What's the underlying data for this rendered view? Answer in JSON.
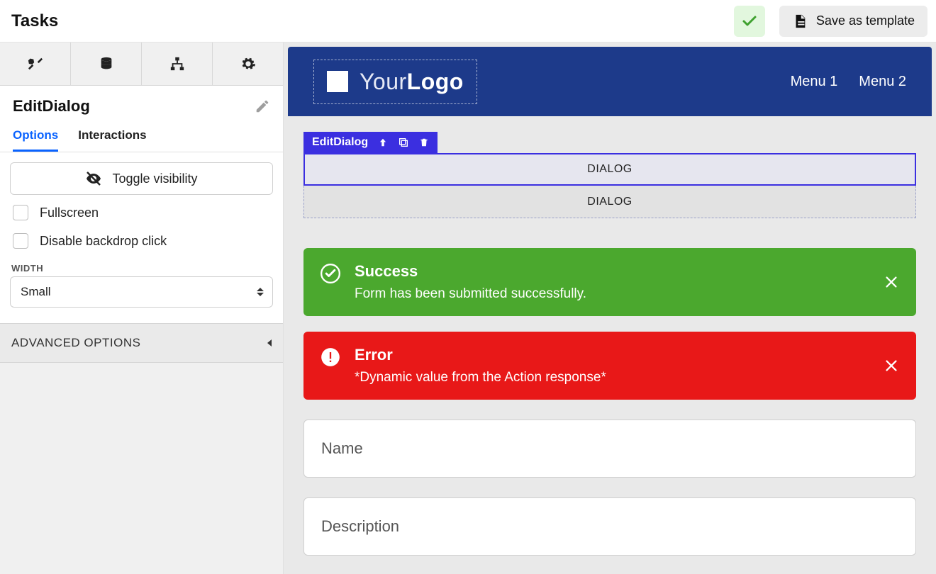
{
  "header": {
    "title": "Tasks",
    "save_label": "Save as template"
  },
  "sidebar": {
    "component_name": "EditDialog",
    "tabs": {
      "options": "Options",
      "interactions": "Interactions"
    },
    "toggle_visibility": "Toggle visibility",
    "fullscreen_label": "Fullscreen",
    "disable_backdrop_label": "Disable backdrop click",
    "width_label": "WIDTH",
    "width_value": "Small",
    "advanced_label": "ADVANCED OPTIONS"
  },
  "canvas": {
    "logo_light": "Your",
    "logo_bold": "Logo",
    "menu": [
      "Menu 1",
      "Menu 2"
    ],
    "selection_chip": "EditDialog",
    "dialog_slot_label": "DIALOG",
    "alerts": {
      "success": {
        "title": "Success",
        "message": "Form has been submitted successfully."
      },
      "error": {
        "title": "Error",
        "message": "*Dynamic value from the Action response*"
      }
    },
    "fields": {
      "name": "Name",
      "description": "Description"
    }
  }
}
